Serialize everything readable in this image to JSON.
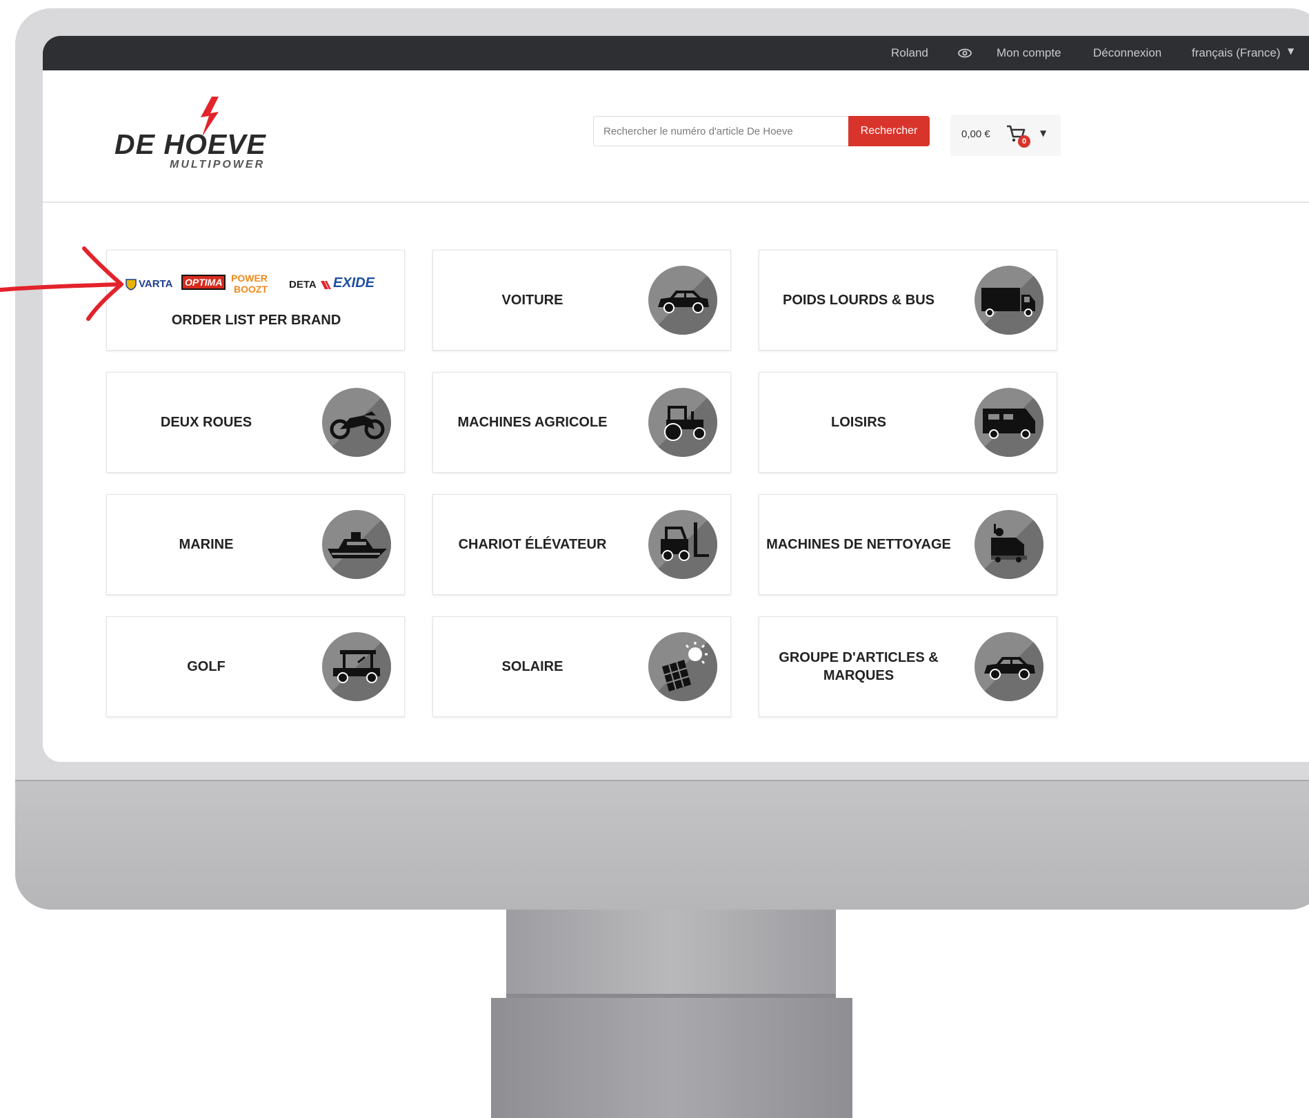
{
  "topbar": {
    "user": "Roland",
    "account": "Mon compte",
    "logout": "Déconnexion",
    "language": "français (France)"
  },
  "logo": {
    "name": "DE HOEVE",
    "sub": "MULTIPOWER"
  },
  "search": {
    "placeholder": "Rechercher le numéro d'article De Hoeve",
    "button": "Rechercher"
  },
  "cart": {
    "total": "0,00 €",
    "count": "0"
  },
  "brands": {
    "varta": "VARTA",
    "optima": "OPTIMA",
    "powerboozt_1": "POWER",
    "powerboozt_2": "BOOZT",
    "deta": "DETA",
    "exide": "EXIDE",
    "label": "ORDER LIST PER BRAND"
  },
  "categories": [
    {
      "label": "VOITURE",
      "icon": "car-icon"
    },
    {
      "label": "POIDS LOURDS & BUS",
      "icon": "truck-icon"
    },
    {
      "label": "DEUX ROUES",
      "icon": "motorcycle-icon"
    },
    {
      "label": "MACHINES AGRICOLE",
      "icon": "tractor-icon"
    },
    {
      "label": "LOISIRS",
      "icon": "camper-icon"
    },
    {
      "label": "MARINE",
      "icon": "boat-icon"
    },
    {
      "label": "CHARIOT ÉLÉVATEUR",
      "icon": "forklift-icon"
    },
    {
      "label": "MACHINES DE NETTOYAGE",
      "icon": "cleaning-machine-icon"
    },
    {
      "label": "GOLF",
      "icon": "golf-cart-icon"
    },
    {
      "label": "SOLAIRE",
      "icon": "solar-panel-icon"
    },
    {
      "label": "GROUPE D'ARTICLES & MARQUES",
      "icon": "car-icon"
    }
  ],
  "colors": {
    "topbar": "#2e2f33",
    "accent": "#d9342b",
    "icon_circle": "#8a8a8a",
    "annotation": "#e3232b"
  }
}
